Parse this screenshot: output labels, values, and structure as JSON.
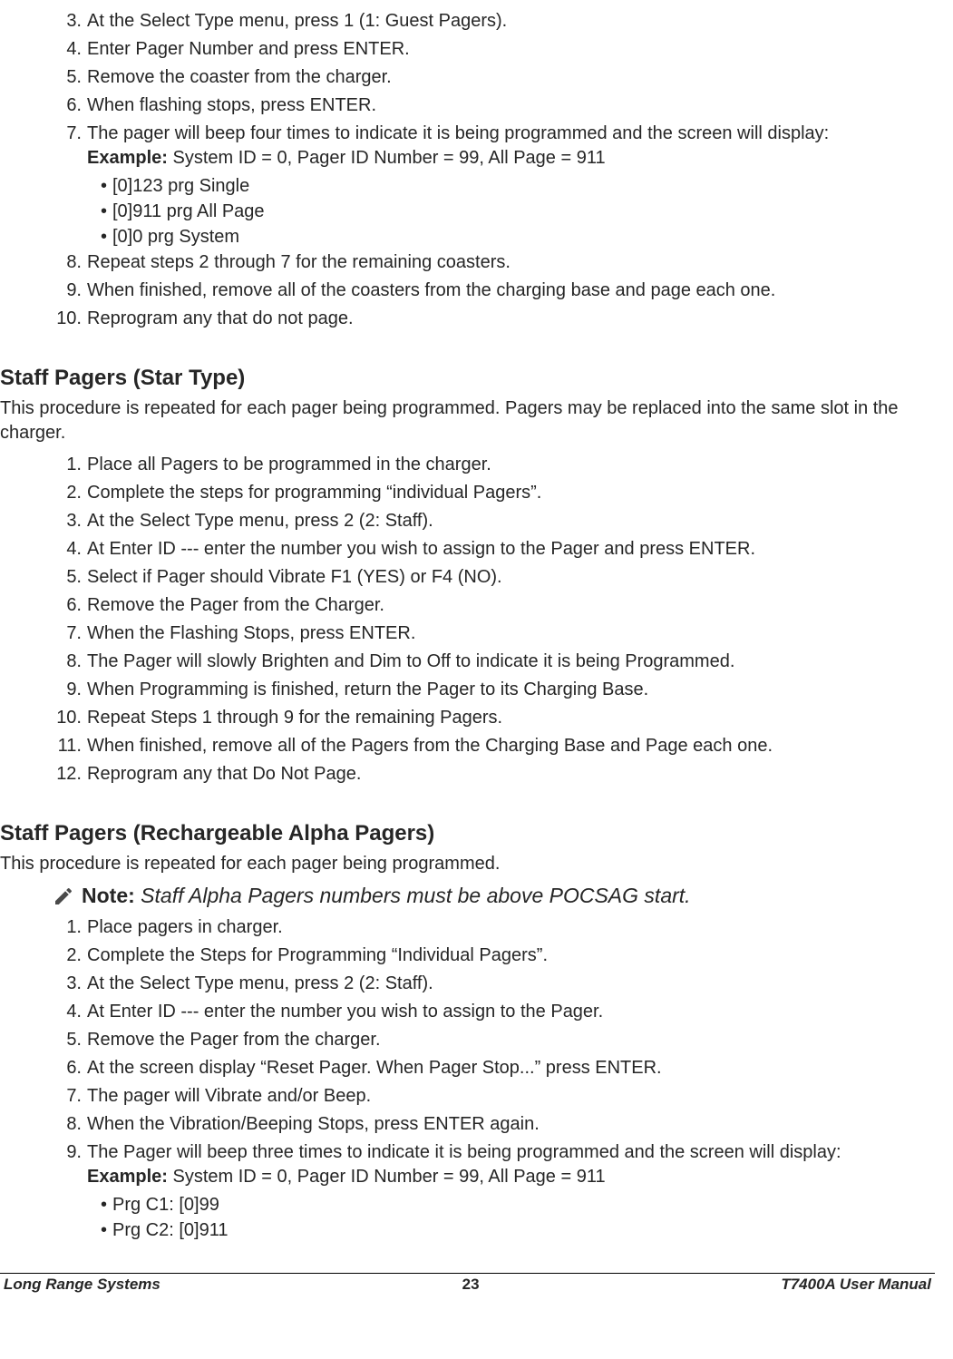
{
  "section_a": {
    "items": [
      {
        "num": "3.",
        "text": "At the Select Type menu, press 1 (1: Guest Pagers)."
      },
      {
        "num": "4.",
        "text": "Enter Pager Number and press ENTER."
      },
      {
        "num": "5.",
        "text": "Remove the coaster from the charger."
      },
      {
        "num": "6.",
        "text": "When flashing stops, press ENTER."
      },
      {
        "num": "7.",
        "text": "The pager will beep four times to indicate it is being programmed and the screen will display:"
      }
    ],
    "example_label": "Example:",
    "example_text": " System ID = 0, Pager ID Number = 99, All Page = 911",
    "bullets": [
      "[0]123 prg Single",
      "[0]911 prg All Page",
      "[0]0 prg System"
    ],
    "items_after": [
      {
        "num": "8.",
        "text": "Repeat steps 2 through 7 for the remaining coasters."
      },
      {
        "num": "9.",
        "text": "When finished, remove all of the coasters from the charging base and page each one."
      },
      {
        "num": "10.",
        "text": "Reprogram any that do not page."
      }
    ]
  },
  "section_b": {
    "heading": "Staff Pagers (Star Type)",
    "intro": "This procedure is repeated for each pager being programmed. Pagers may be replaced into the same slot in the charger.",
    "items": [
      {
        "num": "1.",
        "text": "Place all Pagers to be programmed in the charger."
      },
      {
        "num": "2.",
        "text": "Complete the steps for programming “individual Pagers”."
      },
      {
        "num": "3.",
        "text": "At the Select Type menu, press 2 (2: Staff)."
      },
      {
        "num": "4.",
        "text": "At Enter ID --- enter the number you wish to assign to the Pager and press ENTER."
      },
      {
        "num": "5.",
        "text": "Select if Pager should Vibrate F1 (YES) or F4 (NO)."
      },
      {
        "num": "6.",
        "text": "Remove the Pager from the Charger."
      },
      {
        "num": "7.",
        "text": "When the Flashing Stops, press ENTER."
      },
      {
        "num": "8.",
        "text": "The Pager will slowly Brighten and Dim to Off to indicate it is being Programmed."
      },
      {
        "num": "9.",
        "text": "When Programming is finished, return the Pager to its Charging Base."
      },
      {
        "num": "10.",
        "text": "Repeat Steps 1 through 9 for the remaining Pagers."
      },
      {
        "num": "11.",
        "text": "When finished, remove all of the Pagers from the Charging Base and Page each one."
      },
      {
        "num": "12.",
        "text": "Reprogram any that Do Not Page."
      }
    ]
  },
  "section_c": {
    "heading": "Staff Pagers (Rechargeable Alpha Pagers)",
    "intro": "This procedure is repeated for each pager being programmed.",
    "note_label": "Note:",
    "note_text": " Staff Alpha Pagers numbers must be above POCSAG start.",
    "items": [
      {
        "num": "1.",
        "text": "Place pagers in charger."
      },
      {
        "num": "2.",
        "text": "Complete the Steps for Programming “Individual Pagers”."
      },
      {
        "num": "3.",
        "text": "At the Select Type menu, press 2 (2: Staff)."
      },
      {
        "num": "4.",
        "text": "At Enter ID --- enter the number you wish to assign to the Pager."
      },
      {
        "num": "5.",
        "text": "Remove the Pager from the charger."
      },
      {
        "num": "6.",
        "text": "At the screen display “Reset Pager. When Pager Stop...” press ENTER."
      },
      {
        "num": "7.",
        "text": "The pager will Vibrate and/or Beep."
      },
      {
        "num": "8.",
        "text": "When the Vibration/Beeping Stops, press ENTER again."
      },
      {
        "num": "9.",
        "text": "The Pager will beep three times to indicate it is being programmed and the screen will display:"
      }
    ],
    "example_label": "Example:",
    "example_text": " System ID = 0, Pager ID Number = 99, All Page = 911",
    "bullets": [
      "Prg C1: [0]99",
      "Prg C2: [0]911"
    ]
  },
  "footer": {
    "left": "Long Range Systems",
    "center": "23",
    "right": "T7400A User Manual"
  }
}
